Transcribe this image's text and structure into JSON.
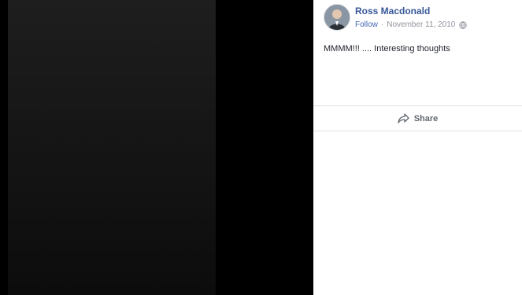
{
  "post": {
    "author_name": "Ross Macdonald",
    "follow_label": "Follow",
    "separator": "·",
    "date": "November 11, 2010",
    "privacy_icon": "globe-icon",
    "caption": "MMMM!!! .... Interesting thoughts"
  },
  "actions": {
    "share_label": "Share",
    "share_icon": "share-arrow-icon"
  },
  "colors": {
    "author_link": "#385898",
    "follow_link": "#4267b2",
    "meta_text": "#90949c",
    "body_text": "#1d2129",
    "action_text": "#606770",
    "divider": "#dddfe2",
    "photo_background": "#000000"
  }
}
